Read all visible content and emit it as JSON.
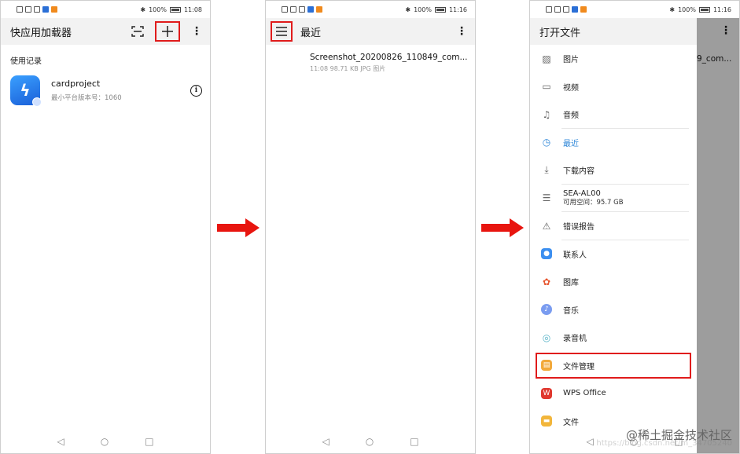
{
  "panel1": {
    "status_time": "11:08",
    "battery": "100%",
    "title": "快应用加载器",
    "section_label": "使用记录",
    "app": {
      "name": "cardproject",
      "subtitle": "最小平台版本号：1060"
    }
  },
  "panel2": {
    "status_time": "11:16",
    "battery": "100%",
    "title": "最近",
    "file": {
      "name": "Screenshot_20200826_110849_com...",
      "meta": "11:08 98.71 KB JPG 图片"
    }
  },
  "panel3": {
    "status_time": "11:16",
    "battery": "100%",
    "drawer_title": "打开文件",
    "behind_text": "9_com...",
    "items": [
      {
        "label": "图片",
        "icon": "image-icon"
      },
      {
        "label": "视频",
        "icon": "video-icon"
      },
      {
        "label": "音频",
        "icon": "audio-icon"
      },
      {
        "label": "最近",
        "icon": "clock-icon"
      },
      {
        "label": "下载内容",
        "icon": "download-icon"
      },
      {
        "label": "SEA-AL00",
        "sub": "可用空间：95.7 GB",
        "icon": "storage-icon"
      },
      {
        "label": "错误报告",
        "icon": "bug-report-icon"
      },
      {
        "label": "联系人",
        "icon": "contacts-icon"
      },
      {
        "label": "图库",
        "icon": "gallery-icon"
      },
      {
        "label": "音乐",
        "icon": "music-icon"
      },
      {
        "label": "录音机",
        "icon": "recorder-icon"
      },
      {
        "label": "文件管理",
        "icon": "file-manager-icon"
      },
      {
        "label": "WPS Office",
        "icon": "wps-icon"
      },
      {
        "label": "文件",
        "icon": "files-icon"
      }
    ]
  },
  "watermark": {
    "text": "@稀土掘金技术社区",
    "faint": "https://blog.csdn.net/m_34705240"
  },
  "colors": {
    "highlight": "#e01b1b",
    "accent": "#2f87d8",
    "arrow": "#e8150f"
  }
}
